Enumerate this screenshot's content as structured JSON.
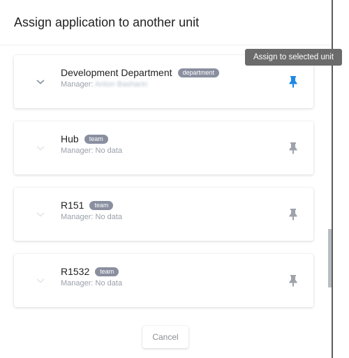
{
  "dialog": {
    "title": "Assign application to another unit",
    "cancel_label": "Cancel"
  },
  "tooltip": {
    "text": "Assign to selected unit"
  },
  "units": [
    {
      "name": "Development Department",
      "badge": "department",
      "manager_prefix": "Manager:",
      "manager_value": "Anton Basharin",
      "manager_blurred": true,
      "pin_color": "#1e88e5",
      "chevron_color": "#8a93a3"
    },
    {
      "name": "Hub",
      "badge": "team",
      "manager_prefix": "Manager:",
      "manager_value": "No data",
      "manager_blurred": false,
      "pin_color": "#9ea3ab",
      "chevron_color": "#e3e6ea"
    },
    {
      "name": "R151",
      "badge": "team",
      "manager_prefix": "Manager:",
      "manager_value": "No data",
      "manager_blurred": false,
      "pin_color": "#9ea3ab",
      "chevron_color": "#e3e6ea"
    },
    {
      "name": "R1532",
      "badge": "team",
      "manager_prefix": "Manager:",
      "manager_value": "No data",
      "manager_blurred": false,
      "pin_color": "#9ea3ab",
      "chevron_color": "#e3e6ea"
    }
  ],
  "icons": {
    "chevron": "chevron-down-icon",
    "pin": "pin-icon"
  }
}
